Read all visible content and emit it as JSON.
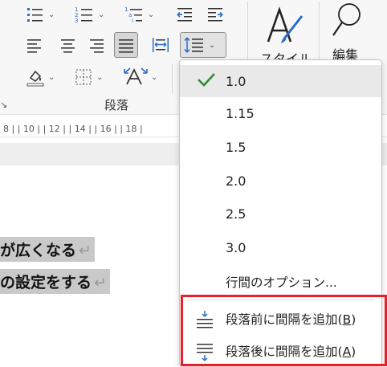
{
  "ribbon": {
    "group_label": "段落",
    "styles_label": "スタイル",
    "edit_label": "編集",
    "colors": {
      "blue": "#2b6cc4",
      "icon_gray": "#333333"
    },
    "icons": [
      "bullets-icon",
      "numbering-icon",
      "multilevel-list-icon",
      "decrease-indent-icon",
      "increase-indent-icon",
      "align-left-icon",
      "align-center-icon",
      "align-right-icon",
      "justify-icon",
      "distributed-icon",
      "line-spacing-icon",
      "shading-icon",
      "borders-icon",
      "asian-layout-icon",
      "styles-icon",
      "search-icon"
    ]
  },
  "ruler": {
    "text": "8 |   | 10 |   | 12 |   | 14 |   | 16 |   | 18 |"
  },
  "document": {
    "lines": [
      {
        "text": "が広くなる",
        "mark": "↵"
      },
      {
        "text": "の設定をする",
        "mark": "↵"
      }
    ]
  },
  "menu": {
    "values": [
      {
        "label": "1.0",
        "checked": true
      },
      {
        "label": "1.15",
        "checked": false
      },
      {
        "label": "1.5",
        "checked": false
      },
      {
        "label": "2.0",
        "checked": false
      },
      {
        "label": "2.5",
        "checked": false
      },
      {
        "label": "3.0",
        "checked": false
      }
    ],
    "options_label": "行間のオプション...",
    "add_before_label": "段落前に間隔を追加(",
    "add_before_key": "B",
    "add_after_label": "段落後に間隔を追加(",
    "add_after_key": "A",
    "close_paren": ")",
    "highlight_color": "#e8202a"
  }
}
